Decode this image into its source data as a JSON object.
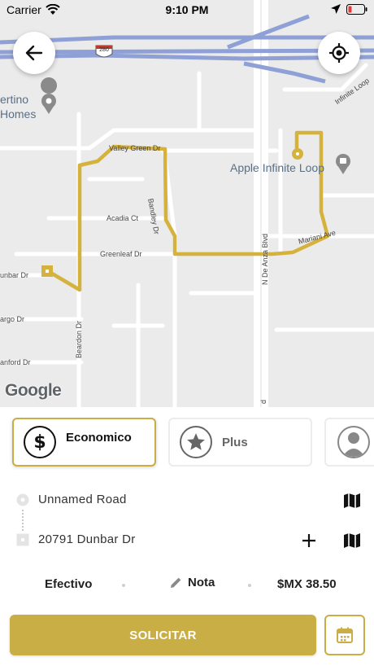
{
  "status_bar": {
    "carrier": "Carrier",
    "time": "9:10 PM",
    "icons": [
      "wifi-icon",
      "location-arrow-icon",
      "battery-low-icon"
    ]
  },
  "map": {
    "streets": {
      "valley_green": "Valley Green Dr",
      "acadia": "Acadia Ct",
      "greenleaf": "Greenleaf Dr",
      "bandley": "Bandley Dr",
      "mariani": "Mariani Ave",
      "n_de_anza": "N De Anza Blvd",
      "infinite_loop": "Infinite Loop",
      "dunbar": "unbar Dr",
      "beardon": "Beardon Dr",
      "argo": "argo Dr",
      "anford": "anford Dr",
      "de_anza_edge": "d"
    },
    "pois": {
      "apple": "Apple Infinite Loop",
      "cupertino_line1": "ertino",
      "cupertino_line2": "Homes"
    },
    "highway_shield": "280",
    "attribution": "Google",
    "route_color": "#d4b23c"
  },
  "vehicle_options": [
    {
      "label": "Economico",
      "icon": "dollar-icon",
      "selected": true
    },
    {
      "label": "Plus",
      "icon": "star-icon",
      "selected": false
    },
    {
      "label": "",
      "icon": "person-icon",
      "selected": false
    }
  ],
  "route": {
    "origin": "Unnamed Road",
    "destination": "20791 Dunbar Dr"
  },
  "trip": {
    "payment": "Efectivo",
    "note_label": "Nota",
    "price": "$MX 38.50"
  },
  "actions": {
    "request_label": "SOLICITAR"
  },
  "colors": {
    "accent": "#c9ad45",
    "highway": "#8ea0d6"
  }
}
